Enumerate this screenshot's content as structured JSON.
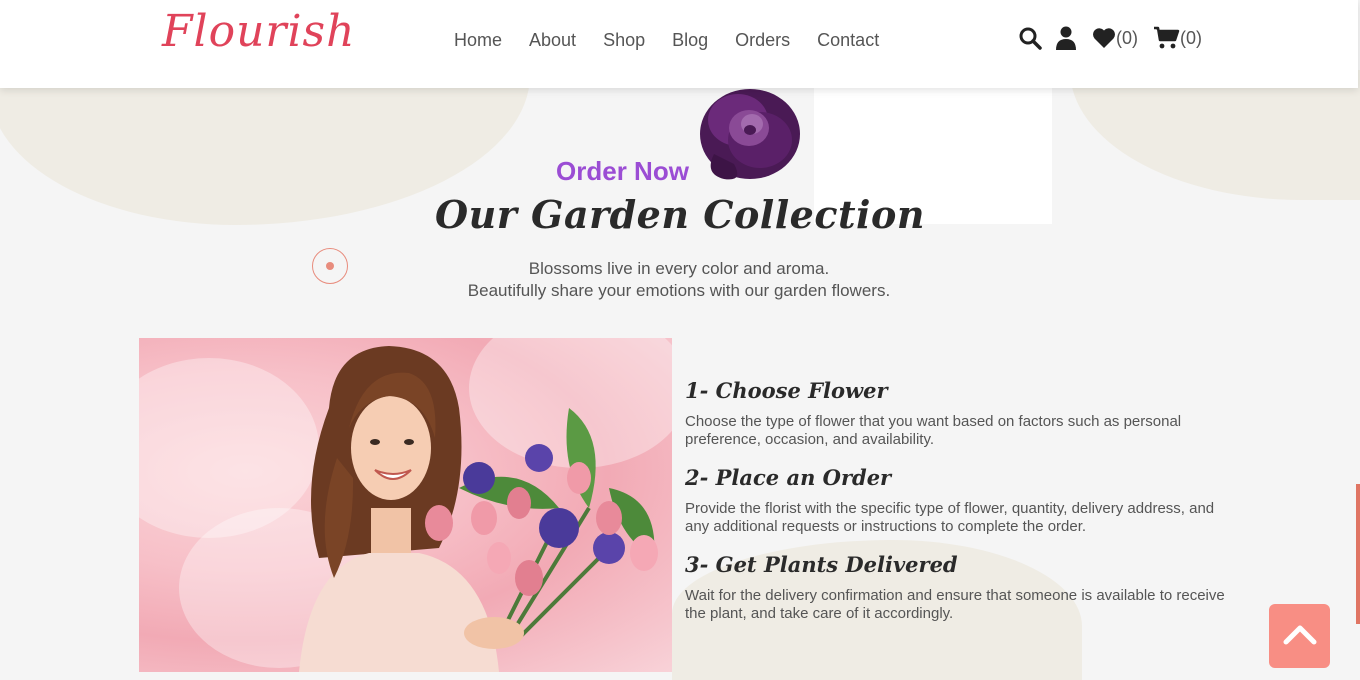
{
  "header": {
    "logo": "Flourish",
    "nav": [
      "Home",
      "About",
      "Shop",
      "Blog",
      "Orders",
      "Contact"
    ],
    "wishlist_count": "(0)",
    "cart_count": "(0)",
    "icons": [
      "search-icon",
      "user-icon",
      "heart-icon",
      "cart-icon"
    ]
  },
  "hero": {
    "eyebrow": "Order Now",
    "title": "Our Garden Collection",
    "subtitle_line1": "Blossoms live in every color and aroma.",
    "subtitle_line2": "Beautifully share your emotions with our garden flowers."
  },
  "steps": [
    {
      "title": "1- Choose Flower",
      "text": "Choose the type of flower that you want based on factors such as personal preference, occasion, and availability."
    },
    {
      "title": "2- Place an Order",
      "text": "Provide the florist with the specific type of flower, quantity, delivery address, and any additional requests or instructions to complete the order."
    },
    {
      "title": "3- Get Plants Delivered",
      "text": "Wait for the delivery confirmation and ensure that someone is available to receive the plant, and take care of it accordingly."
    }
  ],
  "colors": {
    "accent_purple": "#9b4dd4",
    "logo_red": "#e0435a",
    "back_to_top": "#f88e84",
    "blob": "#efece4"
  }
}
